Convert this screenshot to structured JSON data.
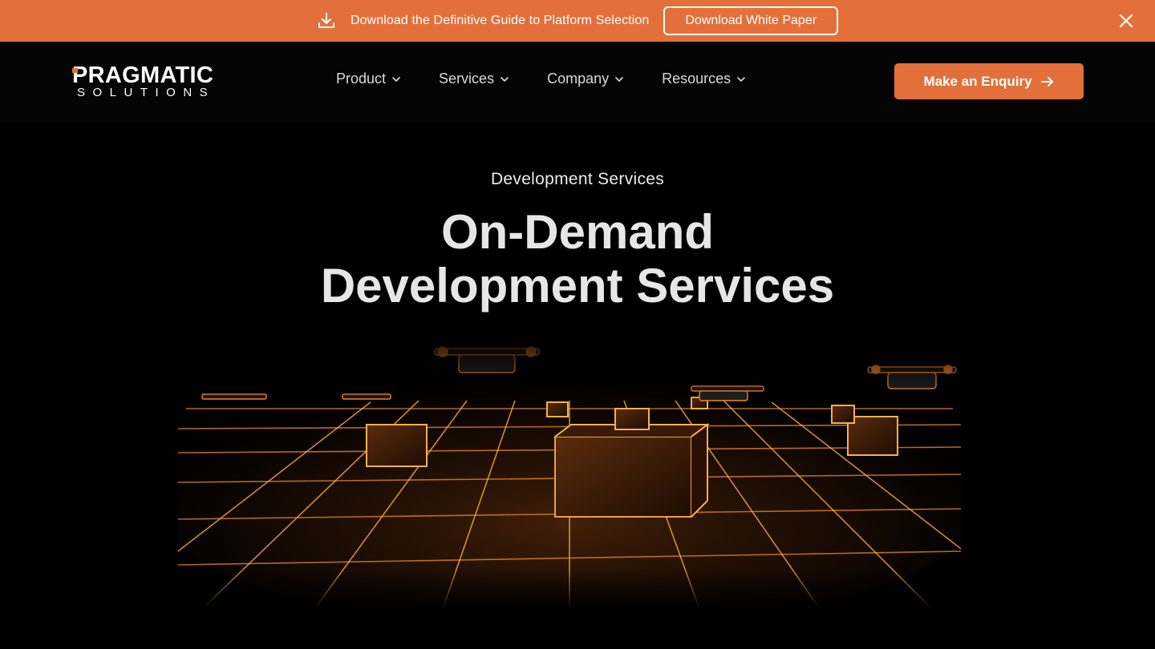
{
  "banner": {
    "text": "Download the Definitive Guide to Platform Selection",
    "button_label": "Download White Paper",
    "icons": {
      "download": "download-icon",
      "close": "close-icon"
    },
    "background": "#e3703a"
  },
  "header": {
    "logo": {
      "main": "PRAGMATIC",
      "sub": "SOLUTIONS"
    },
    "nav": [
      {
        "label": "Product"
      },
      {
        "label": "Services"
      },
      {
        "label": "Company"
      },
      {
        "label": "Resources"
      }
    ],
    "cta_label": "Make an Enquiry",
    "accent": "#e3703a"
  },
  "hero": {
    "eyebrow": "Development Services",
    "title_line1": "On-Demand",
    "title_line2": "Development Services",
    "image": "glowing-grid-drones-illustration"
  }
}
